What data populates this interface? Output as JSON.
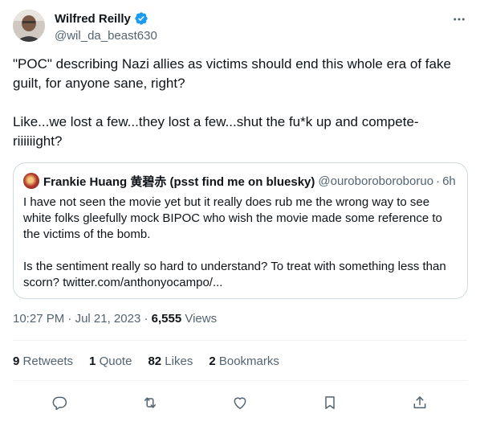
{
  "author": {
    "display_name": "Wilfred Reilly",
    "handle": "@wil_da_beast630",
    "avatar_icon": "profile-photo"
  },
  "tweet": {
    "text": "\"POC\" describing Nazi allies as victims should end this whole era of fake guilt, for anyone sane, right?\n\nLike...we lost a few...they lost a few...shut the fu*k up and compete-riiiiiight?"
  },
  "quoted_tweet": {
    "display_name": "Frankie Huang 黄碧赤 (psst find me on bluesky)",
    "handle": "@ouroboroboroboruo",
    "time": "6h",
    "text": "I have not seen the movie yet but it really does rub me the wrong way to see white folks gleefully mock BIPOC who wish the movie made some reference to the victims of the bomb.\n\nIs the sentiment really so hard to understand? To treat with something less than scorn? twitter.com/anthonyocampo/..."
  },
  "meta": {
    "time": "10:27 PM",
    "date": "Jul 21, 2023",
    "views_count": "6,555",
    "views_label": "Views"
  },
  "stats": {
    "retweets_count": "9",
    "retweets_label": "Retweets",
    "quotes_count": "1",
    "quotes_label": "Quote",
    "likes_count": "82",
    "likes_label": "Likes",
    "bookmarks_count": "2",
    "bookmarks_label": "Bookmarks"
  },
  "colors": {
    "text_primary": "#0f1419",
    "text_secondary": "#536471",
    "verified_blue": "#1d9bf0",
    "border": "#cfd9de"
  }
}
